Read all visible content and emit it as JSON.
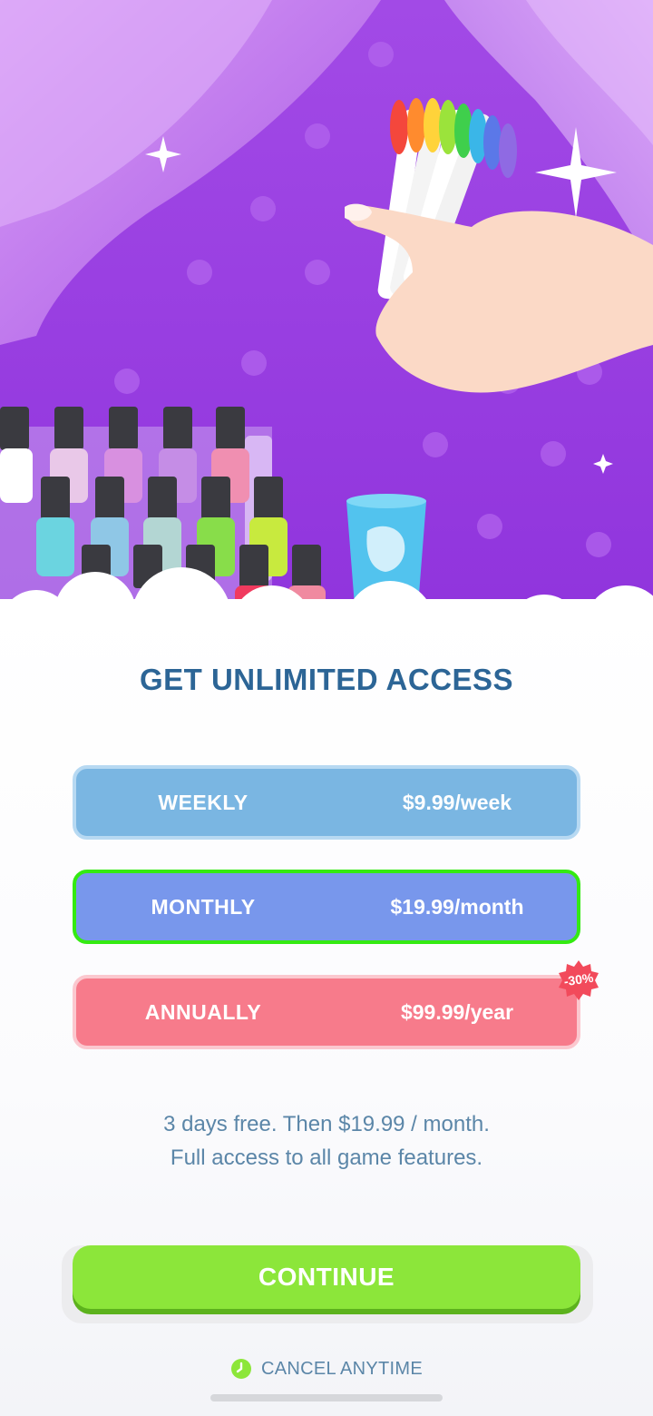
{
  "header": {
    "title": "GET UNLIMITED ACCESS"
  },
  "plans": [
    {
      "name": "WEEKLY",
      "price": "$9.99/week",
      "color": "#7ab6e2",
      "selected": false
    },
    {
      "name": "MONTHLY",
      "price": "$19.99/month",
      "color": "#7897ec",
      "selected": true
    },
    {
      "name": "ANNUALLY",
      "price": "$99.99/year",
      "color": "#f77b8b",
      "selected": false,
      "badge": "-30%"
    }
  ],
  "description": {
    "line1": "3 days free. Then $19.99 / month.",
    "line2": "Full access to all game features."
  },
  "continue_label": "CONTINUE",
  "cancel_label": "CANCEL ANYTIME",
  "colors": {
    "title": "#2c6596",
    "selected_border": "#34ea12",
    "continue": "#8ce63a",
    "hero_background": "#9a3ee0"
  },
  "icons": {
    "cancel": "clock-icon",
    "badge": "discount-badge-icon"
  }
}
